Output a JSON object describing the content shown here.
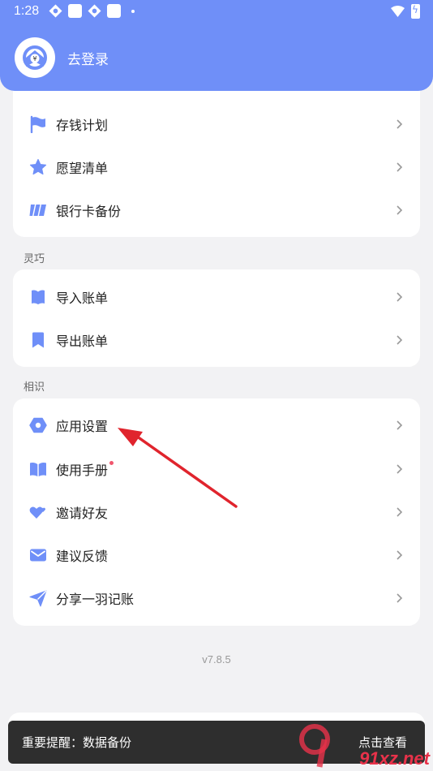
{
  "status": {
    "time": "1:28"
  },
  "profile": {
    "login_label": "去登录"
  },
  "group_top": {
    "items": [
      {
        "label": "存钱计划",
        "icon": "flag-icon"
      },
      {
        "label": "愿望清单",
        "icon": "star-icon"
      },
      {
        "label": "银行卡备份",
        "icon": "bank-card-icon"
      }
    ]
  },
  "group_lingqiao": {
    "title": "灵巧",
    "items": [
      {
        "label": "导入账单",
        "icon": "import-book-icon"
      },
      {
        "label": "导出账单",
        "icon": "export-bookmark-icon"
      }
    ]
  },
  "group_xiangshi": {
    "title": "相识",
    "items": [
      {
        "label": "应用设置",
        "icon": "settings-hexagon-icon"
      },
      {
        "label": "使用手册",
        "icon": "manual-book-icon"
      },
      {
        "label": "邀请好友",
        "icon": "hearts-icon"
      },
      {
        "label": "建议反馈",
        "icon": "mail-icon"
      },
      {
        "label": "分享一羽记账",
        "icon": "send-icon"
      }
    ]
  },
  "version": "v7.8.5",
  "toast": {
    "message": "重要提醒：数据备份",
    "action": "点击查看"
  },
  "watermark": {
    "text": "91xz.net"
  },
  "colors": {
    "accent": "#6f8ff8",
    "arrow": "#e0242d",
    "dot": "#f0566d"
  }
}
